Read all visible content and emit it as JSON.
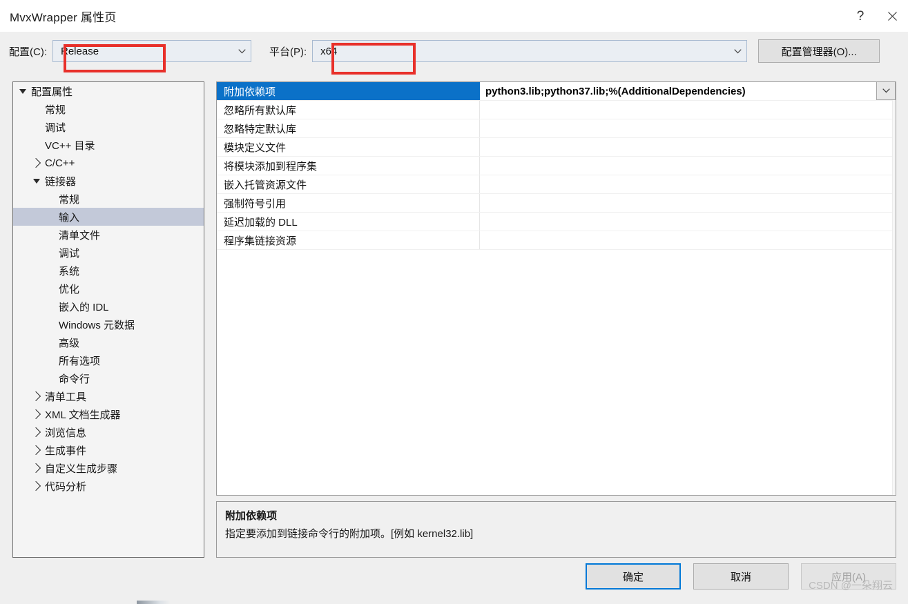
{
  "window": {
    "title": "MvxWrapper 属性页",
    "help_glyph": "?",
    "help_name": "help-button",
    "close_name": "close-button"
  },
  "config_bar": {
    "configuration_label": "配置(C):",
    "configuration_value": "Release",
    "platform_label": "平台(P):",
    "platform_value": "x64",
    "config_manager_label": "配置管理器(O)...",
    "annotation_color": "#e8302a"
  },
  "tree": {
    "items": [
      {
        "label": "配置属性",
        "level": 0,
        "expander": "down",
        "selected": false
      },
      {
        "label": "常规",
        "level": 1,
        "expander": "none",
        "selected": false
      },
      {
        "label": "调试",
        "level": 1,
        "expander": "none",
        "selected": false
      },
      {
        "label": "VC++ 目录",
        "level": 1,
        "expander": "none",
        "selected": false
      },
      {
        "label": "C/C++",
        "level": 1,
        "expander": "right",
        "selected": false
      },
      {
        "label": "链接器",
        "level": 1,
        "expander": "down",
        "selected": false
      },
      {
        "label": "常规",
        "level": 2,
        "expander": "none",
        "selected": false
      },
      {
        "label": "输入",
        "level": 2,
        "expander": "none",
        "selected": true
      },
      {
        "label": "清单文件",
        "level": 2,
        "expander": "none",
        "selected": false
      },
      {
        "label": "调试",
        "level": 2,
        "expander": "none",
        "selected": false
      },
      {
        "label": "系统",
        "level": 2,
        "expander": "none",
        "selected": false
      },
      {
        "label": "优化",
        "level": 2,
        "expander": "none",
        "selected": false
      },
      {
        "label": "嵌入的 IDL",
        "level": 2,
        "expander": "none",
        "selected": false
      },
      {
        "label": "Windows 元数据",
        "level": 2,
        "expander": "none",
        "selected": false
      },
      {
        "label": "高级",
        "level": 2,
        "expander": "none",
        "selected": false
      },
      {
        "label": "所有选项",
        "level": 2,
        "expander": "none",
        "selected": false
      },
      {
        "label": "命令行",
        "level": 2,
        "expander": "none",
        "selected": false
      },
      {
        "label": "清单工具",
        "level": 1,
        "expander": "right",
        "selected": false
      },
      {
        "label": "XML 文档生成器",
        "level": 1,
        "expander": "right",
        "selected": false
      },
      {
        "label": "浏览信息",
        "level": 1,
        "expander": "right",
        "selected": false
      },
      {
        "label": "生成事件",
        "level": 1,
        "expander": "right",
        "selected": false
      },
      {
        "label": "自定义生成步骤",
        "level": 1,
        "expander": "right",
        "selected": false
      },
      {
        "label": "代码分析",
        "level": 1,
        "expander": "right",
        "selected": false
      }
    ]
  },
  "grid": {
    "rows": [
      {
        "name": "附加依赖项",
        "value": "python3.lib;python37.lib;%(AdditionalDependencies)",
        "selected": true
      },
      {
        "name": "忽略所有默认库",
        "value": "",
        "selected": false
      },
      {
        "name": "忽略特定默认库",
        "value": "",
        "selected": false
      },
      {
        "name": "模块定义文件",
        "value": "",
        "selected": false
      },
      {
        "name": "将模块添加到程序集",
        "value": "",
        "selected": false
      },
      {
        "name": "嵌入托管资源文件",
        "value": "",
        "selected": false
      },
      {
        "name": "强制符号引用",
        "value": "",
        "selected": false
      },
      {
        "name": "延迟加载的 DLL",
        "value": "",
        "selected": false
      },
      {
        "name": "程序集链接资源",
        "value": "",
        "selected": false
      }
    ]
  },
  "description": {
    "title": "附加依赖项",
    "text": "指定要添加到链接命令行的附加项。[例如 kernel32.lib]"
  },
  "footer": {
    "ok_label": "确定",
    "cancel_label": "取消",
    "apply_label": "应用(A)",
    "apply_disabled": true
  },
  "watermark": {
    "text": "CSDN @一朵翔云"
  }
}
